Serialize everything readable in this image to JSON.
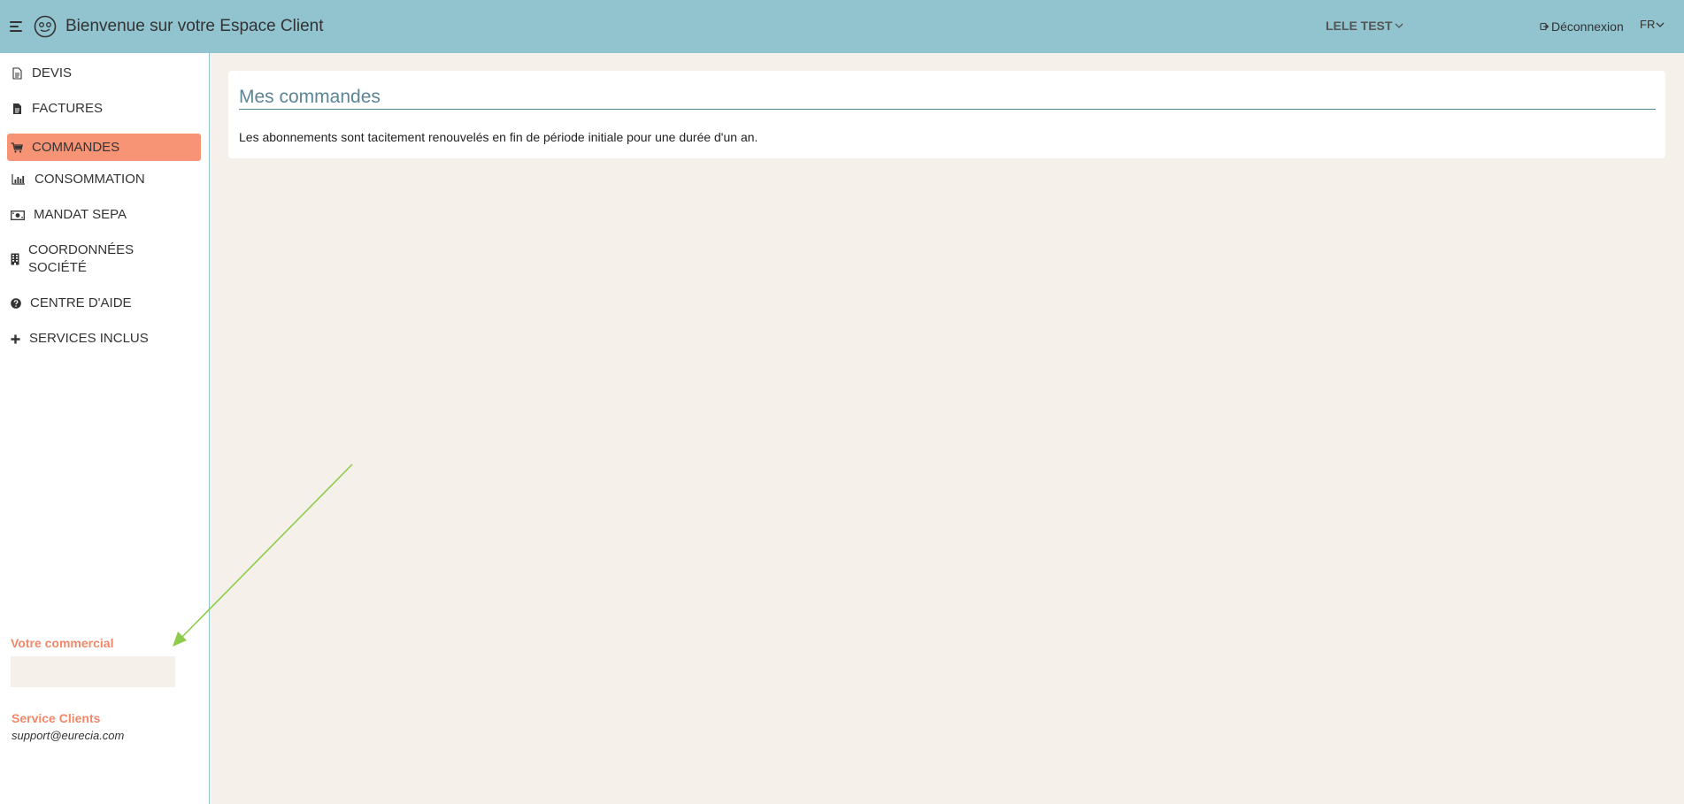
{
  "header": {
    "title": "Bienvenue sur votre Espace Client",
    "user_name": "LELE TEST",
    "logout_label": "Déconnexion",
    "language": "FR",
    "background_color": "#91c4cf"
  },
  "sidebar": {
    "items": [
      {
        "label": "DEVIS",
        "icon": "document-icon"
      },
      {
        "label": "FACTURES",
        "icon": "invoice-icon"
      },
      {
        "label": "COMMANDES",
        "icon": "cart-icon",
        "active": true
      },
      {
        "label": "CONSOMMATION",
        "icon": "bar-chart-icon"
      },
      {
        "label": "MANDAT SEPA",
        "icon": "money-icon"
      },
      {
        "label_line1": "COORDONNÉES",
        "label_line2": "SOCIÉTÉ",
        "icon": "building-icon"
      },
      {
        "label": "CENTRE D'AIDE",
        "icon": "question-circle-icon"
      },
      {
        "label": "SERVICES INCLUS",
        "icon": "plus-icon"
      }
    ],
    "active_color": "#f79476",
    "commercial_label": "Votre commercial",
    "service_label": "Service Clients",
    "support_email": "support@eurecia.com"
  },
  "main": {
    "title": "Mes commandes",
    "description": "Les abonnements sont tacitement renouvelés en fin de période initiale pour une durée d'un an."
  },
  "annotation": {
    "type": "arrow",
    "color": "#8ccc4a"
  }
}
